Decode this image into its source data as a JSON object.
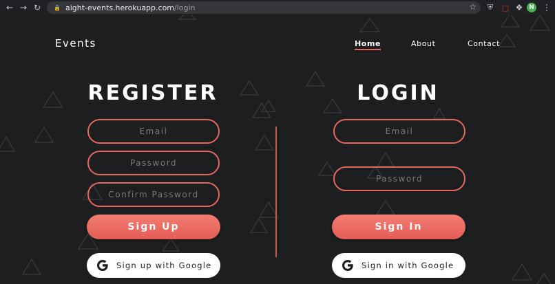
{
  "browser": {
    "url_host": "aight-events.herokuapp.com",
    "url_path": "/login",
    "profile_initial": "N"
  },
  "header": {
    "brand": "Events",
    "nav": [
      {
        "label": "Home",
        "active": true
      },
      {
        "label": "About",
        "active": false
      },
      {
        "label": "Contact",
        "active": false
      }
    ]
  },
  "register": {
    "title": "REGISTER",
    "email_placeholder": "Email",
    "password_placeholder": "Password",
    "confirm_placeholder": "Confirm Password",
    "submit_label": "Sign Up",
    "google_label": "Sign up with Google"
  },
  "login": {
    "title": "LOGIN",
    "email_placeholder": "Email",
    "password_placeholder": "Password",
    "submit_label": "Sign In",
    "google_label": "Sign in with Google"
  },
  "colors": {
    "accent": "#e8685f",
    "background": "#1d1e20"
  }
}
